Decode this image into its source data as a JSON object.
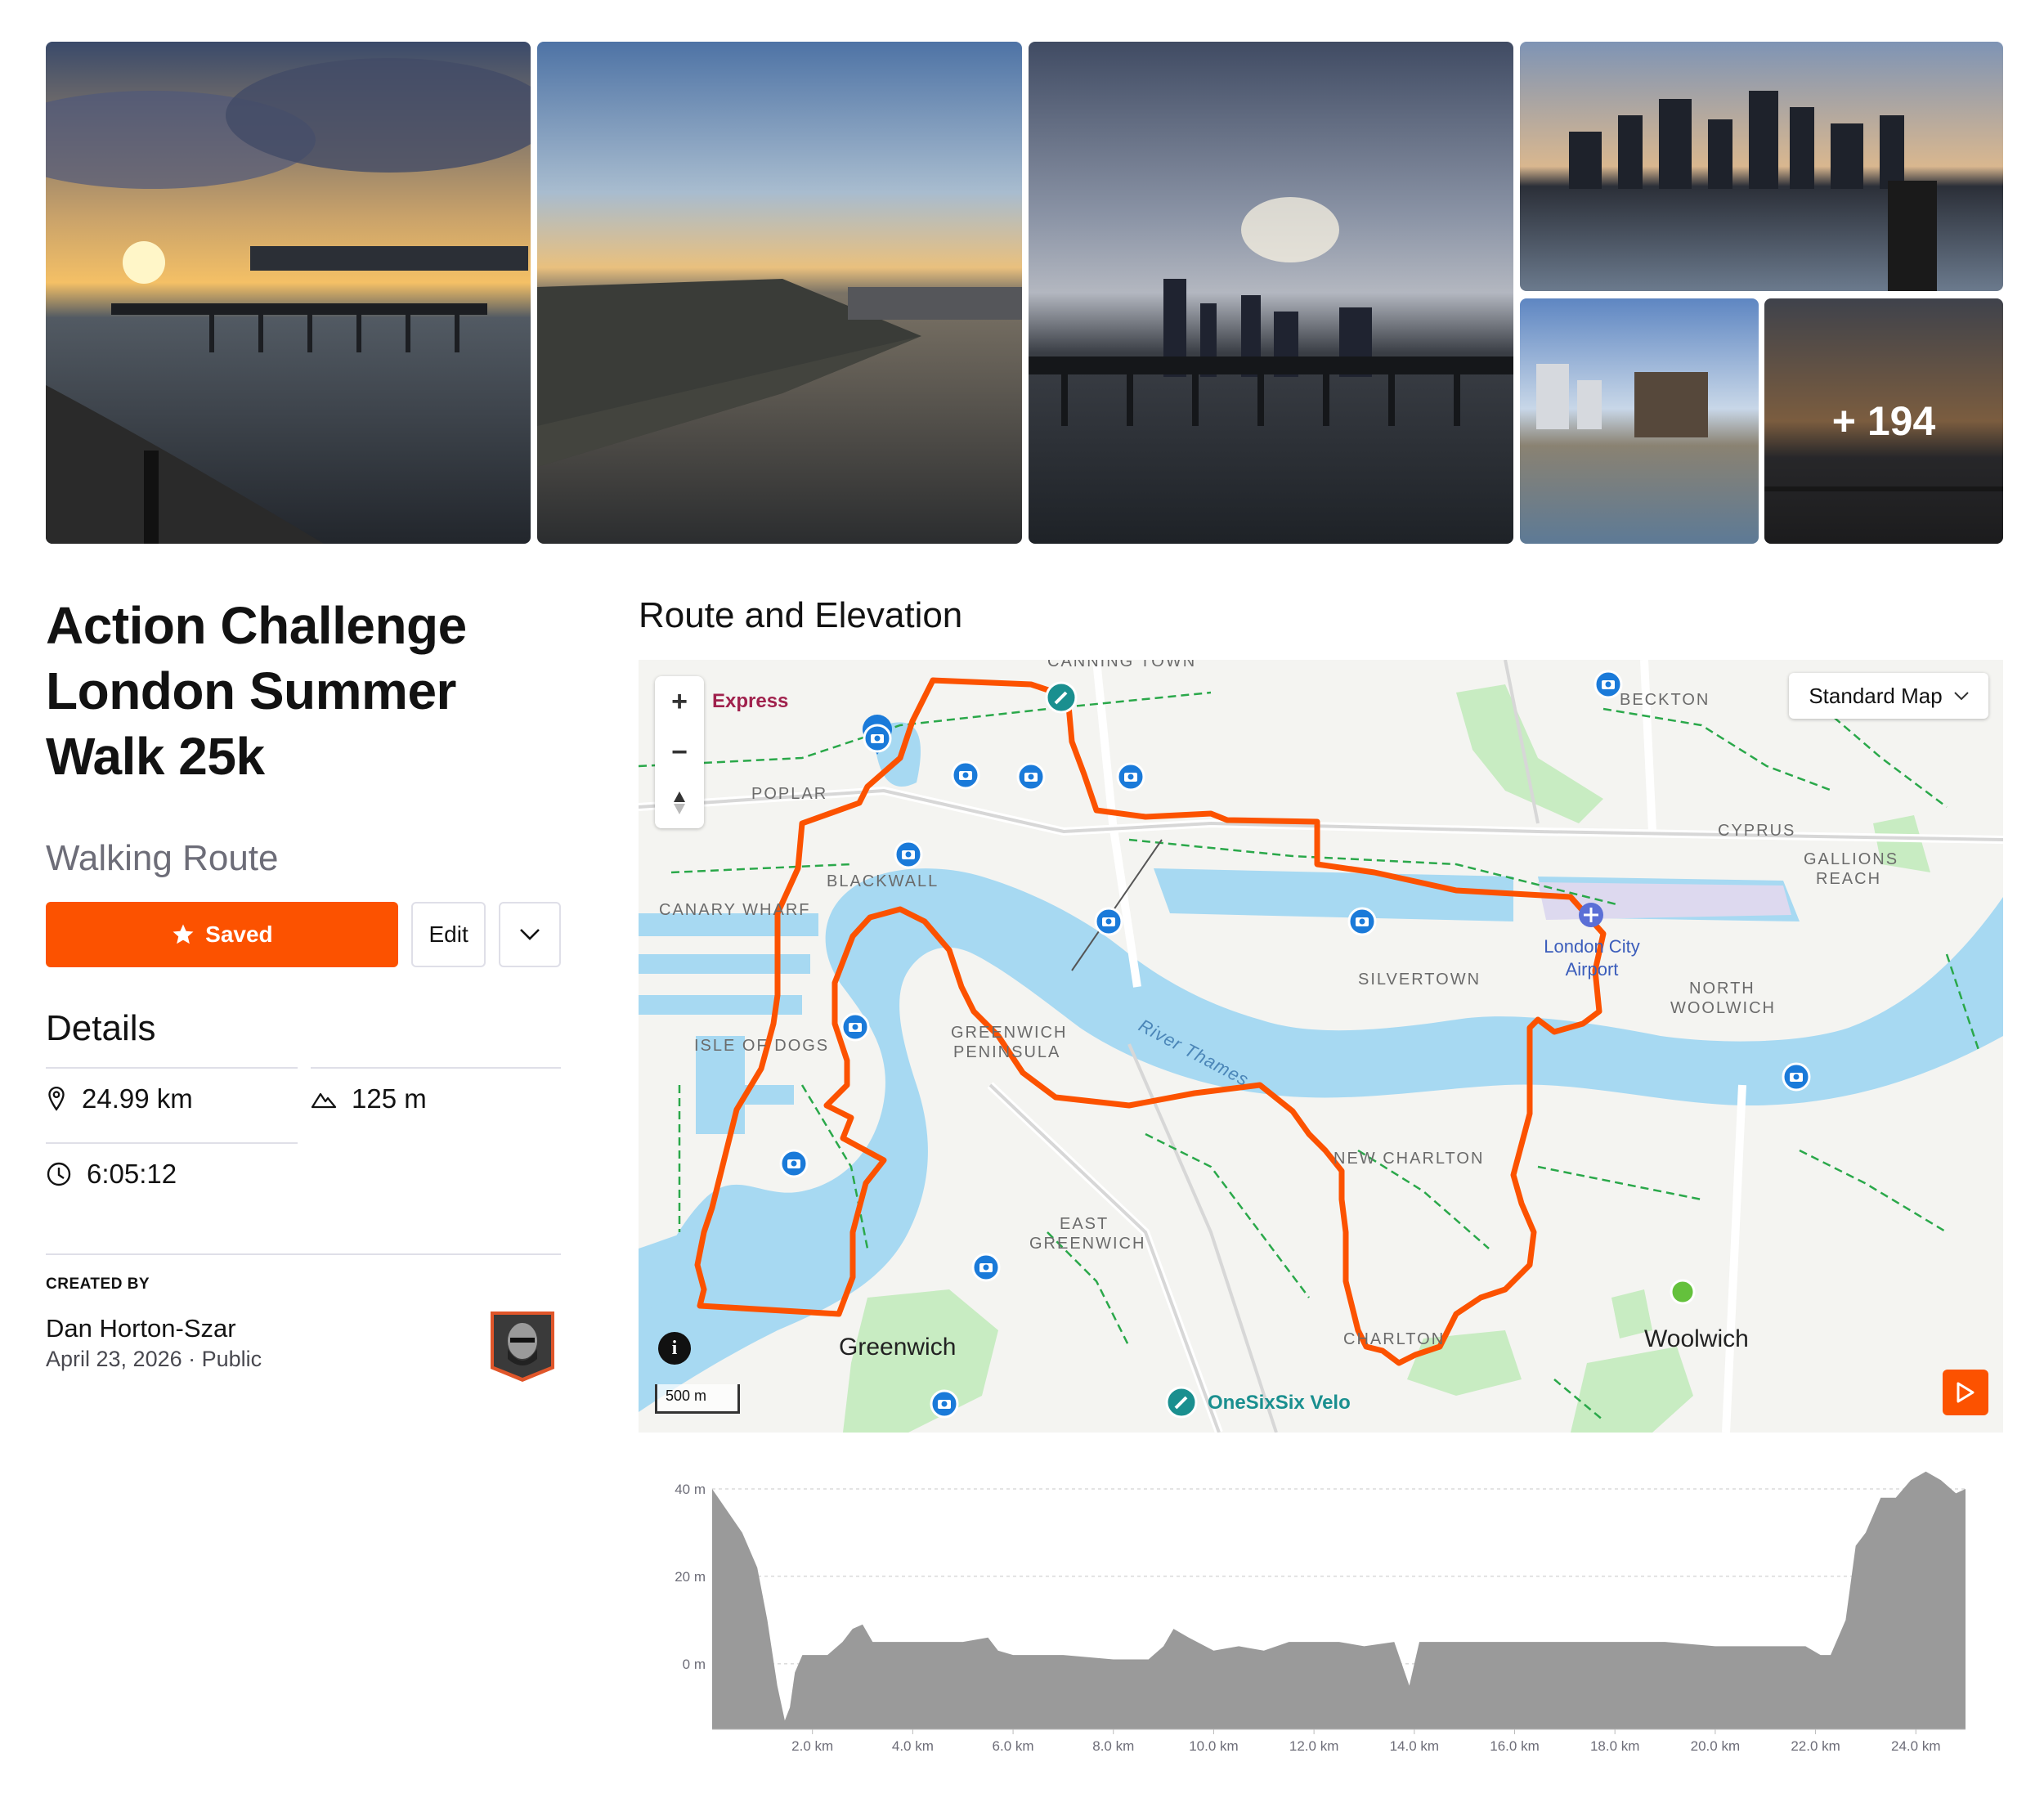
{
  "gallery": {
    "more_count": "+ 194"
  },
  "route": {
    "title": "Action Challenge London Summer Walk 25k",
    "type": "Walking Route"
  },
  "actions": {
    "saved_label": "Saved",
    "edit_label": "Edit"
  },
  "details": {
    "heading": "Details",
    "distance": "24.99 km",
    "elevation_gain": "125 m",
    "duration": "6:05:12"
  },
  "creator": {
    "label": "CREATED BY",
    "name": "Dan Horton-Szar",
    "date": "April 23, 2026",
    "visibility": "Public"
  },
  "map": {
    "section_title": "Route and Elevation",
    "map_type": "Standard Map",
    "scale": "500 m",
    "zoom_in": "+",
    "zoom_out": "−",
    "info": "i",
    "place_labels": [
      "CANNING TOWN",
      "Express",
      "BECKTON",
      "POPLAR",
      "CYPRUS",
      "GALLIONS",
      "REACH",
      "BLACKWALL",
      "CANARY WHARF",
      "London City",
      "Airport",
      "SILVERTOWN",
      "NORTH",
      "WOOLWICH",
      "GREENWICH",
      "PENINSULA",
      "ISLE OF DOGS",
      "River Thames",
      "NEW CHARLTON",
      "EAST",
      "GREENWICH",
      "Greenwich",
      "CHARLTON",
      "Woolwich",
      "OneSixSix Velo"
    ],
    "colors": {
      "route": "#fc5200",
      "water": "#a7d9f2",
      "park": "#c8ecc2",
      "photo_pin": "#1a7ad9",
      "start": "#64c13c"
    }
  },
  "chart_data": {
    "type": "area",
    "xlabel": "",
    "ylabel": "",
    "ylim": [
      -15,
      43
    ],
    "xlim": [
      0,
      24.99
    ],
    "y_tick_labels": [
      "40 m",
      "20 m",
      "0 m"
    ],
    "y_ticks": [
      40,
      20,
      0
    ],
    "x_tick_labels": [
      "2.0 km",
      "4.0 km",
      "6.0 km",
      "8.0 km",
      "10.0 km",
      "12.0 km",
      "14.0 km",
      "16.0 km",
      "18.0 km",
      "20.0 km",
      "22.0 km",
      "24.0 km"
    ],
    "x_ticks": [
      2,
      4,
      6,
      8,
      10,
      12,
      14,
      16,
      18,
      20,
      22,
      24
    ],
    "grid": true,
    "x": [
      0,
      0.3,
      0.6,
      0.9,
      1.1,
      1.3,
      1.45,
      1.55,
      1.65,
      1.8,
      2.0,
      2.3,
      2.6,
      2.8,
      3.0,
      3.2,
      3.5,
      4.0,
      5.0,
      5.5,
      5.7,
      6.0,
      7.0,
      8.0,
      8.7,
      9.0,
      9.2,
      9.5,
      10.0,
      10.5,
      11.0,
      11.5,
      12.0,
      12.5,
      13.0,
      13.6,
      13.9,
      14.1,
      14.3,
      15.0,
      16.0,
      17.0,
      18.0,
      19.0,
      20.0,
      21.0,
      21.8,
      22.1,
      22.3,
      22.6,
      22.8,
      23.0,
      23.3,
      23.6,
      23.9,
      24.2,
      24.5,
      24.8,
      24.99
    ],
    "y": [
      40,
      35,
      30,
      22,
      10,
      -5,
      -13,
      -10,
      -2,
      2,
      2,
      2,
      5,
      8,
      9,
      5,
      5,
      5,
      5,
      6,
      3,
      2,
      2,
      1,
      1,
      4,
      8,
      6,
      3,
      4,
      3,
      5,
      5,
      5,
      4,
      5,
      -5,
      5,
      5,
      5,
      5,
      5,
      5,
      5,
      4,
      4,
      4,
      2,
      2,
      10,
      27,
      30,
      38,
      38,
      42,
      44,
      42,
      39,
      40
    ]
  }
}
